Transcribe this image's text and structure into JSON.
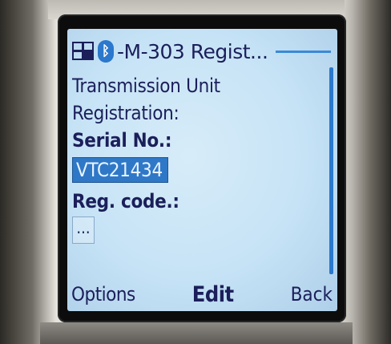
{
  "header": {
    "title": "M-303 Regist...",
    "app_icon": "app-grid-icon",
    "bluetooth_icon": "bluetooth-icon"
  },
  "form": {
    "heading_line1": "Transmission Unit",
    "heading_line2": "Registration:",
    "serial_label": "Serial No.:",
    "serial_value": "VTC21434",
    "reg_label": "Reg. code.:",
    "reg_value": "..."
  },
  "softkeys": {
    "left": "Options",
    "middle": "Edit",
    "right": "Back"
  },
  "colors": {
    "screen_bg": "#c6e3f6",
    "text": "#1b1f5a",
    "accent": "#2f78c8"
  }
}
